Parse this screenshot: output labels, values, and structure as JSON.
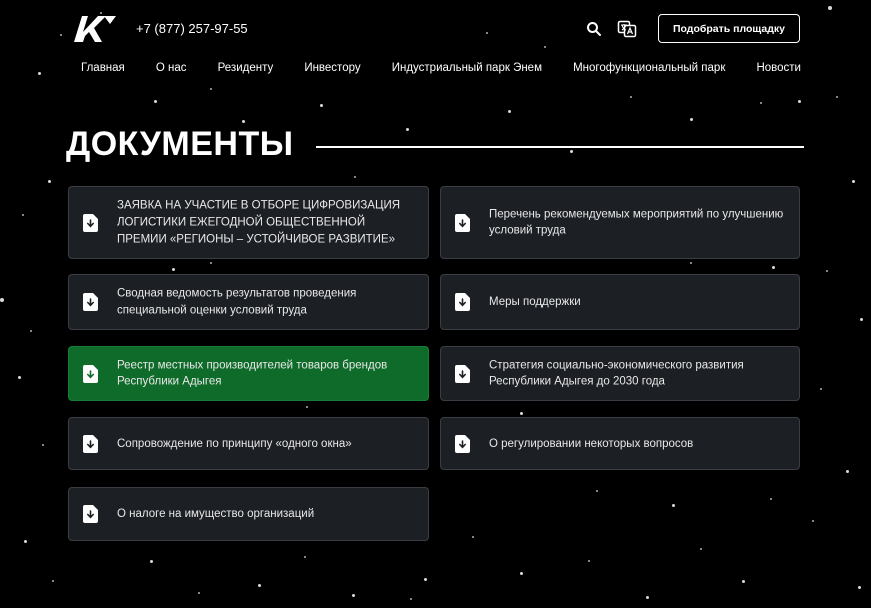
{
  "header": {
    "phone": "+7 (877) 257-97-55",
    "cta_label": "Подобрать площадку",
    "icons": {
      "logo": "brand-logo",
      "search": "search-icon",
      "translate": "translate-icon"
    }
  },
  "nav": {
    "items": [
      "Главная",
      "О нас",
      "Резиденту",
      "Инвестору",
      "Индустриальный парк Энем",
      "Многофункциональный парк",
      "Новости"
    ]
  },
  "main": {
    "title": "ДОКУМЕНТЫ",
    "documents": [
      "ЗАЯВКА НА УЧАСТИЕ В ОТБОРЕ ЦИФРОВИЗАЦИЯ ЛОГИСТИКИ ЕЖЕГОДНОЙ ОБЩЕСТВЕННОЙ ПРЕМИИ «РЕГИОНЫ – УСТОЙЧИВОЕ РАЗВИТИЕ»",
      "Перечень рекомендуемых мероприятий по улучшению условий труда",
      "Сводная ведомость результатов проведения специальной оценки условий труда",
      "Меры поддержки",
      "Реестр местных производителей товаров брендов Республики Адыгея",
      "Стратегия социально-экономического развития Республики Адыгея до 2030 года",
      "Сопровождение по принципу «одного окна»",
      "О регулировании некоторых вопросов",
      "О налоге на имущество организаций"
    ],
    "doc_icon": "document-download-icon",
    "active_document_color": "#0f6b2a",
    "card_color": "#1c1f24"
  }
}
